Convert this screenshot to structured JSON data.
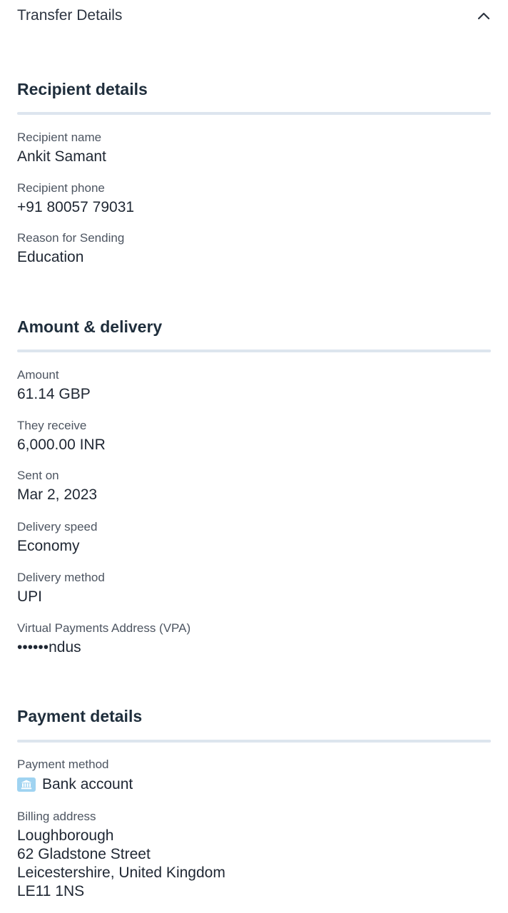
{
  "header": {
    "title": "Transfer Details",
    "collapse_icon": "chevron-up-icon"
  },
  "recipient": {
    "title": "Recipient details",
    "name_label": "Recipient name",
    "name_value": "Ankit Samant",
    "phone_label": "Recipient phone",
    "phone_value": "+91 80057 79031",
    "reason_label": "Reason for Sending",
    "reason_value": "Education"
  },
  "amount": {
    "title": "Amount & delivery",
    "amount_label": "Amount",
    "amount_value": "61.14 GBP",
    "receive_label": "They receive",
    "receive_value": "6,000.00 INR",
    "sent_label": "Sent on",
    "sent_value": "Mar 2, 2023",
    "speed_label": "Delivery speed",
    "speed_value": "Economy",
    "method_label": "Delivery method",
    "method_value": "UPI",
    "vpa_label": "Virtual Payments Address (VPA)",
    "vpa_value": "••••••ndus"
  },
  "payment": {
    "title": "Payment details",
    "method_label": "Payment method",
    "method_icon": "bank-icon",
    "method_value": "Bank account",
    "billing_label": "Billing address",
    "billing_lines": [
      "Loughborough",
      "62 Gladstone Street",
      "Leicestershire, United Kingdom",
      "LE11 1NS"
    ]
  },
  "colors": {
    "divider": "#dde5ee",
    "bank_icon_bg": "#9fd3f1",
    "title_text": "#1f2e3c",
    "label_text": "#4d5561"
  }
}
